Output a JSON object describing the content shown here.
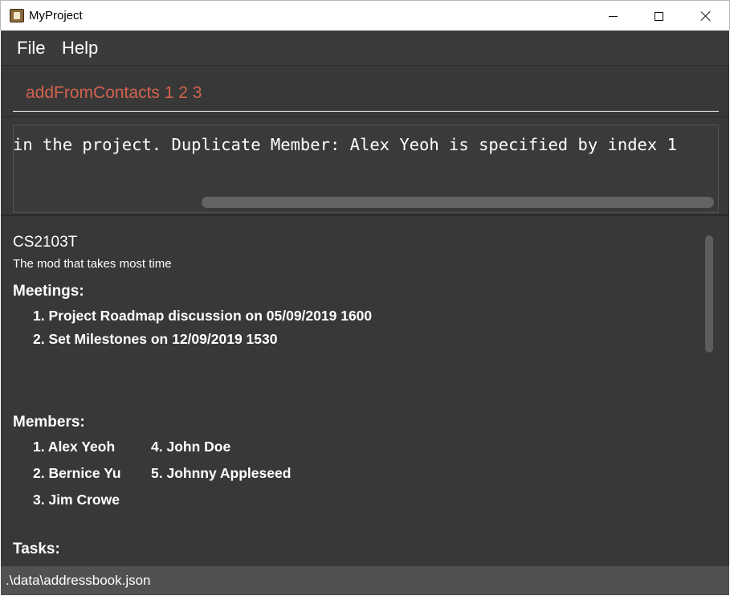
{
  "window": {
    "title": "MyProject",
    "icon": "app-icon"
  },
  "menu": {
    "items": [
      {
        "label": "File"
      },
      {
        "label": "Help"
      }
    ]
  },
  "command": {
    "value": "addFromContacts 1 2 3",
    "color": "#d3634e"
  },
  "result": {
    "text": "in the project. Duplicate Member: Alex Yeoh is specified by index 1"
  },
  "project": {
    "name": "CS2103T",
    "description": "The mod that takes most time",
    "meetings_heading": "Meetings:",
    "meetings": [
      "1. Project Roadmap discussion on 05/09/2019 1600",
      "2. Set Milestones on 12/09/2019 1530"
    ],
    "members_heading": "Members:",
    "members": [
      "1. Alex Yeoh",
      "2. Bernice Yu",
      "3. Jim Crowe",
      "4. John Doe",
      "5. Johnny Appleseed"
    ],
    "tasks_heading": "Tasks:"
  },
  "status": {
    "path": ".\\data\\addressbook.json"
  },
  "colors": {
    "background": "#383838",
    "status_bar": "#515151"
  }
}
